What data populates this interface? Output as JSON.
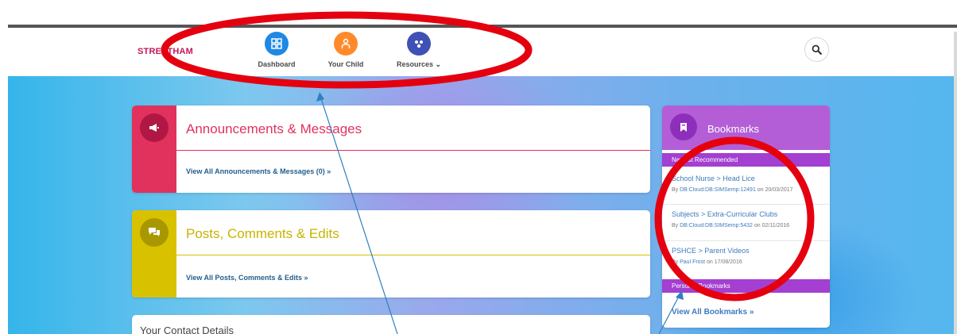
{
  "brand": "STREATHAM",
  "nav": [
    {
      "label": "Dashboard",
      "icon": "dashboard-grid-icon",
      "color": "#1e88e5"
    },
    {
      "label": "Your Child",
      "icon": "child-icon",
      "color": "#ff8a2b"
    },
    {
      "label": "Resources",
      "icon": "resources-icon",
      "color": "#3f51b5"
    }
  ],
  "search_icon": "search-icon",
  "announcements": {
    "title": "Announcements & Messages",
    "link": "View All Announcements & Messages (0) »",
    "color": "#e0325d",
    "badge_color": "#b01744"
  },
  "posts": {
    "title": "Posts, Comments & Edits",
    "link": "View All Posts, Comments & Edits »",
    "color": "#d8c200",
    "badge_color": "#a99700"
  },
  "contact": {
    "title": "Your Contact Details"
  },
  "bookmarks": {
    "title": "Bookmarks",
    "recommended_label": "Newest Recommended",
    "items": [
      {
        "title": "School Nurse > Head Lice",
        "by_prefix": "By ",
        "author": "DB:Cloud:DB:SIMSemp:12491",
        "date_text": " on 20/03/2017"
      },
      {
        "title": "Subjects > Extra-Curricular Clubs",
        "by_prefix": "By ",
        "author": "DB:Cloud:DB:SIMSemp:5432",
        "date_text": " on 02/11/2016"
      },
      {
        "title": "PSHCE > Parent Videos",
        "by_prefix": "By ",
        "author": "Paul Frost",
        "date_text": " on 17/08/2016"
      }
    ],
    "personal_label": "Personal Bookmarks",
    "view_all": "View All Bookmarks »"
  },
  "annotation_color": "#e4000f",
  "arrow_color": "#2f7fc1"
}
